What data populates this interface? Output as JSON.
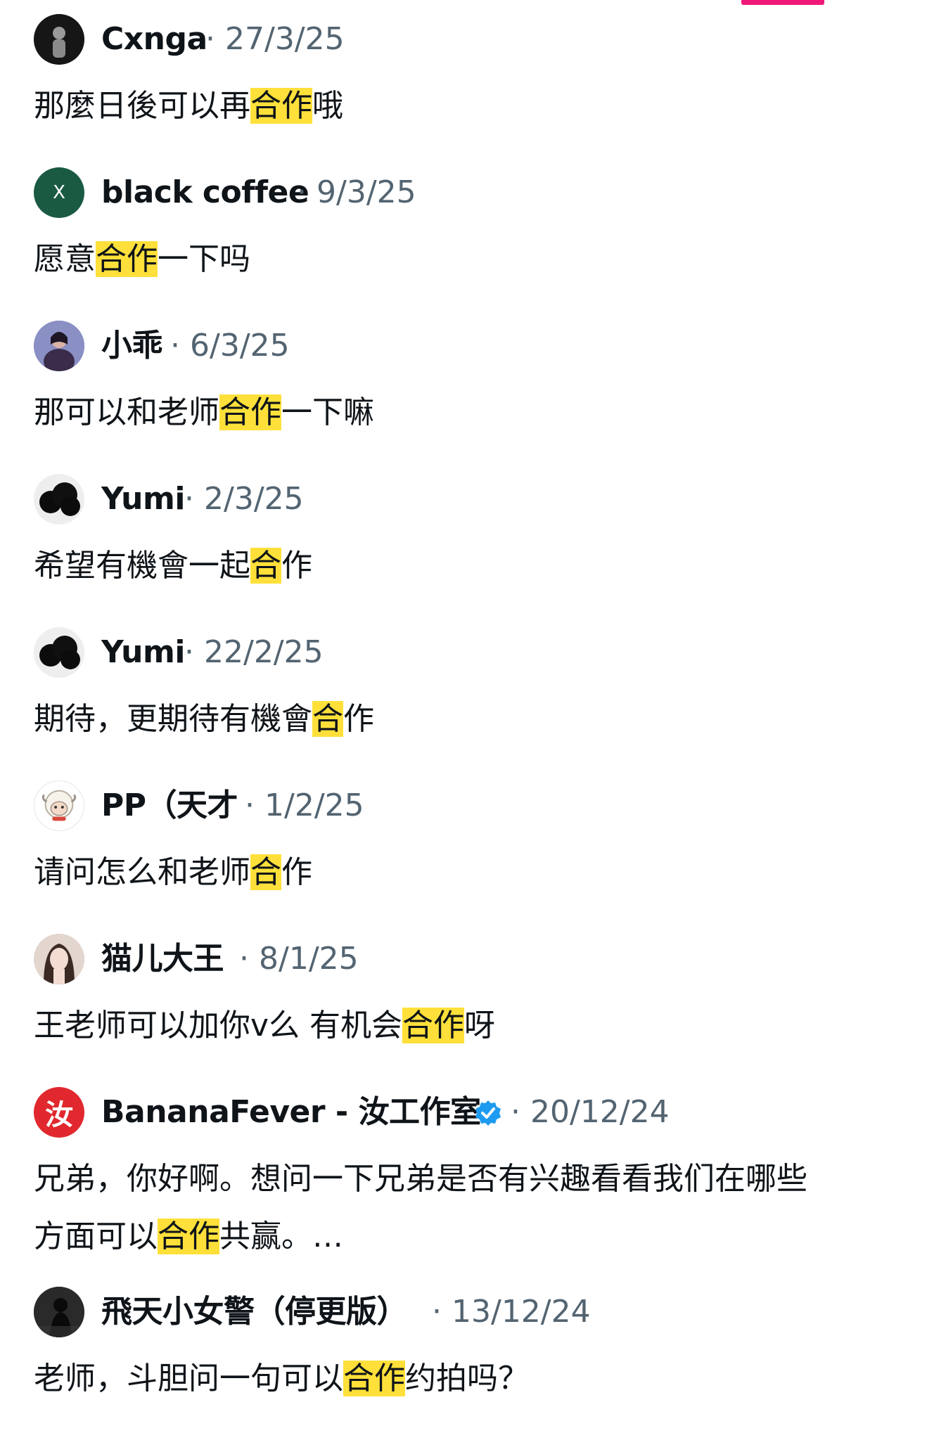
{
  "comments": [
    {
      "name": "Cxnga",
      "date": "27/3/25",
      "text_before": "那麼日後可以再",
      "highlight": "合作",
      "text_after": "哦"
    },
    {
      "name": "black coffee",
      "date": "9/3/25",
      "avatar_letter": "X",
      "text_before": "愿意",
      "highlight": "合作",
      "text_after": "一下吗"
    },
    {
      "name": "小乖",
      "date": "6/3/25",
      "text_before": "那可以和老师",
      "highlight": "合作",
      "text_after": "一下嘛"
    },
    {
      "name": "Yumi",
      "date": "2/3/25",
      "text_before": "希望有機會一起",
      "highlight": "合",
      "text_after": "作"
    },
    {
      "name": "Yumi",
      "date": "22/2/25",
      "text_before": "期待，更期待有機會",
      "highlight": "合",
      "text_after": "作"
    },
    {
      "name": "PP（天才",
      "date": "1/2/25",
      "text_before": "请问怎么和老师",
      "highlight": "合",
      "text_after": "作"
    },
    {
      "name": "猫儿大王",
      "date": "8/1/25",
      "text_before": "王老师可以加你v么 有机会",
      "highlight": "合作",
      "text_after": "呀"
    },
    {
      "name": "BananaFever - 汝工作室",
      "date": "20/12/24",
      "verified": true,
      "avatar_letter": "汝",
      "text_line1": "兄弟，你好啊。想问一下兄弟是否有兴趣看看我们在哪些",
      "text_before": "方面可以",
      "highlight": "合作",
      "text_after": "共赢。…"
    },
    {
      "name": "飛天小女警（停更版）",
      "date": "13/12/24",
      "text_before": "老师，斗胆问一句可以",
      "highlight": "合作",
      "text_after": "约拍吗？"
    }
  ],
  "date_separator": "·",
  "colors": {
    "highlight": "#ffe03a",
    "muted": "#536471",
    "accent_bar": "#f0187a",
    "verified": "#1d9bf0"
  }
}
